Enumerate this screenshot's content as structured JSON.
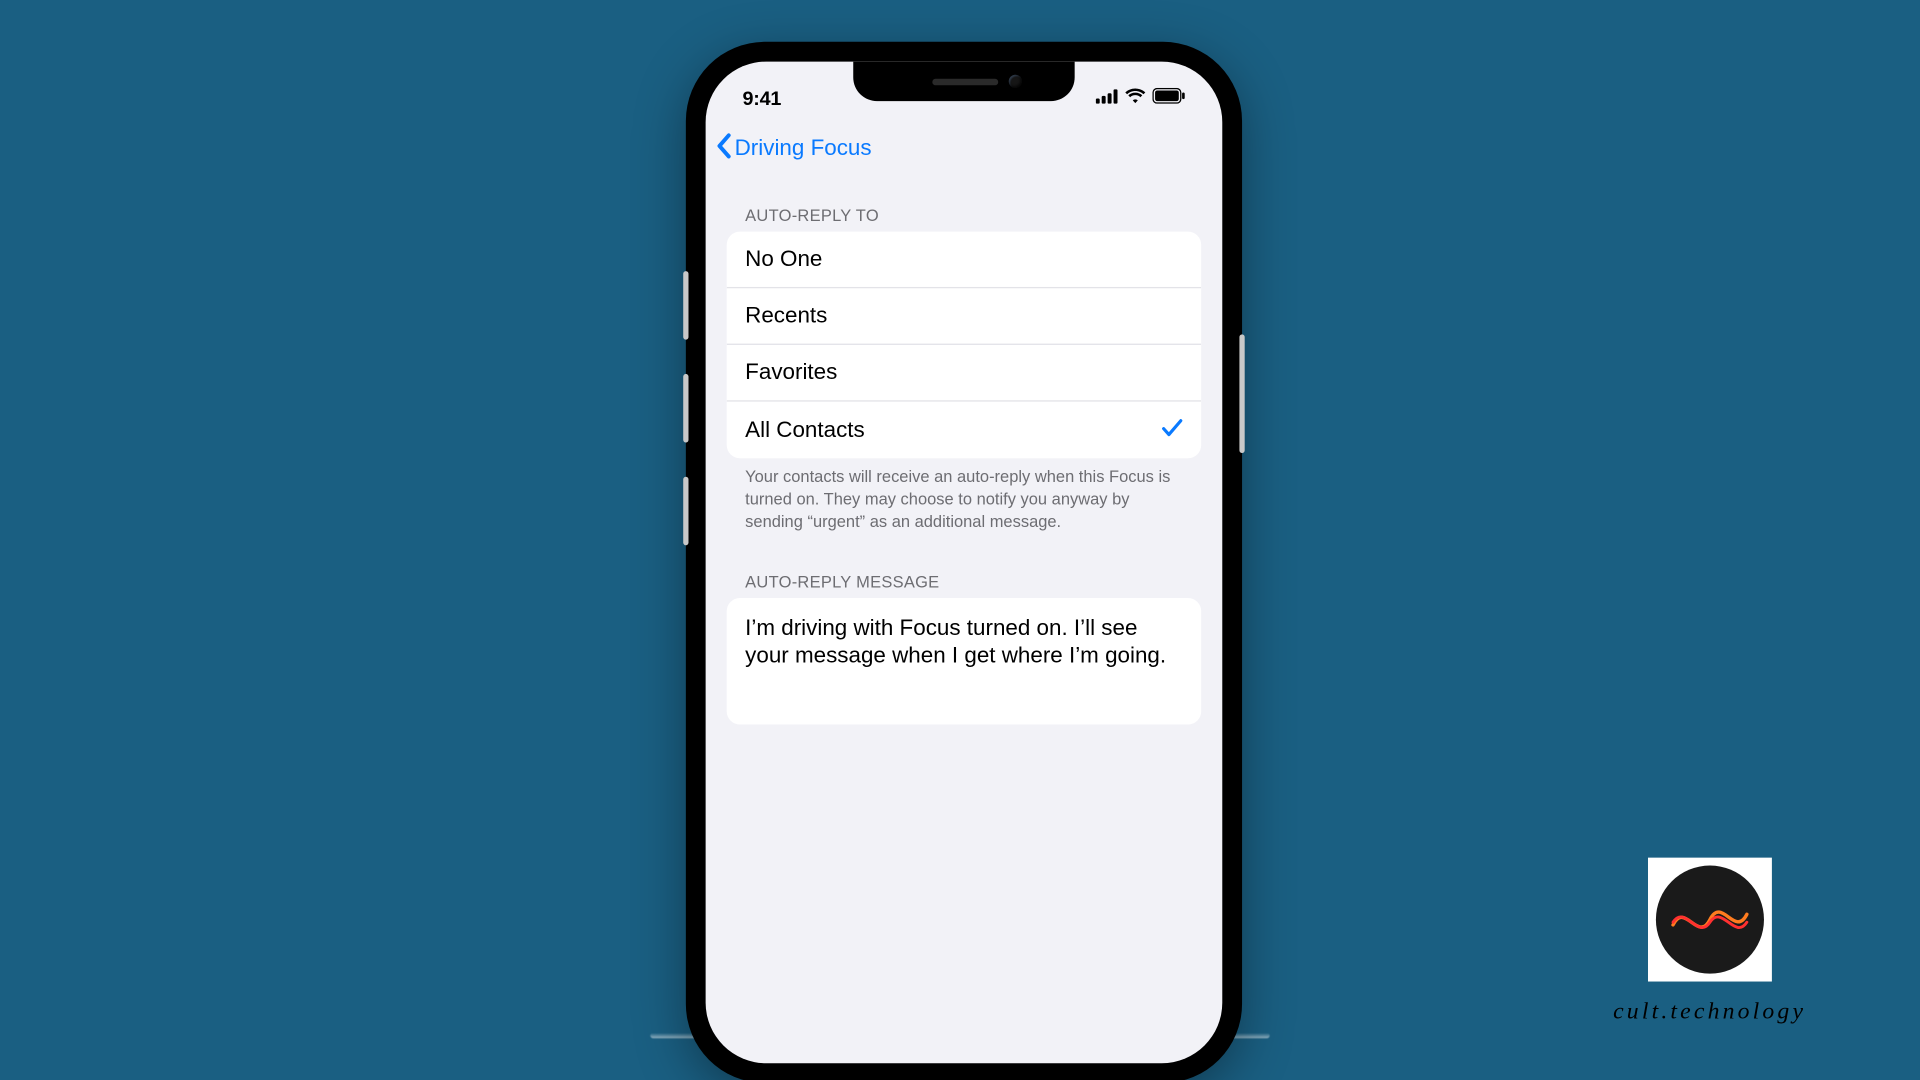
{
  "statusbar": {
    "time": "9:41"
  },
  "nav": {
    "back_label": "Driving Focus"
  },
  "section1": {
    "header": "AUTO-REPLY TO",
    "options": [
      {
        "label": "No One",
        "selected": false
      },
      {
        "label": "Recents",
        "selected": false
      },
      {
        "label": "Favorites",
        "selected": false
      },
      {
        "label": "All Contacts",
        "selected": true
      }
    ],
    "footer": "Your contacts will receive an auto-reply when this Focus is turned on. They may choose to notify you anyway by sending “urgent” as an additional message."
  },
  "section2": {
    "header": "AUTO-REPLY MESSAGE",
    "message": "I’m driving with Focus turned on. I’ll see your message when I get where I’m going."
  },
  "brand": {
    "label": "cult.technology"
  }
}
